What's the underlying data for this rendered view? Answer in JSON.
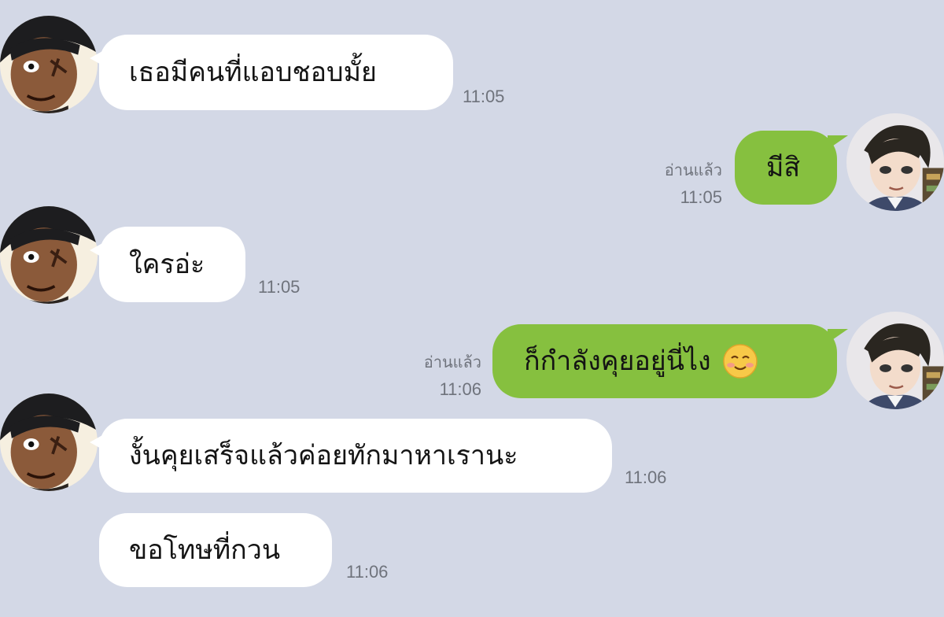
{
  "conversation": {
    "messages": [
      {
        "sender": "them",
        "text": "เธอมีคนที่แอบชอบมั้ย",
        "time": "11:05"
      },
      {
        "sender": "me",
        "text": "มีสิ",
        "read": "อ่านแล้ว",
        "time": "11:05"
      },
      {
        "sender": "them",
        "text": "ใครอ่ะ",
        "time": "11:05"
      },
      {
        "sender": "me",
        "text": "ก็กำลังคุยอยู่นี่ไง",
        "emoji": "smiling-face-emoji",
        "read": "อ่านแล้ว",
        "time": "11:06"
      },
      {
        "sender": "them",
        "text": "งั้นคุยเสร็จแล้วค่อยทักมาหาเรานะ",
        "time": "11:06"
      },
      {
        "sender": "them",
        "text": "ขอโทษที่กวน",
        "time": "11:06"
      }
    ]
  },
  "colors": {
    "background": "#d3d8e6",
    "incoming_bubble": "#ffffff",
    "outgoing_bubble": "#86c03f",
    "meta_text": "#6f737c"
  },
  "icons": {
    "contact_avatar": "contact-avatar",
    "self_avatar": "self-avatar",
    "emoji": "smiling-face-emoji"
  }
}
